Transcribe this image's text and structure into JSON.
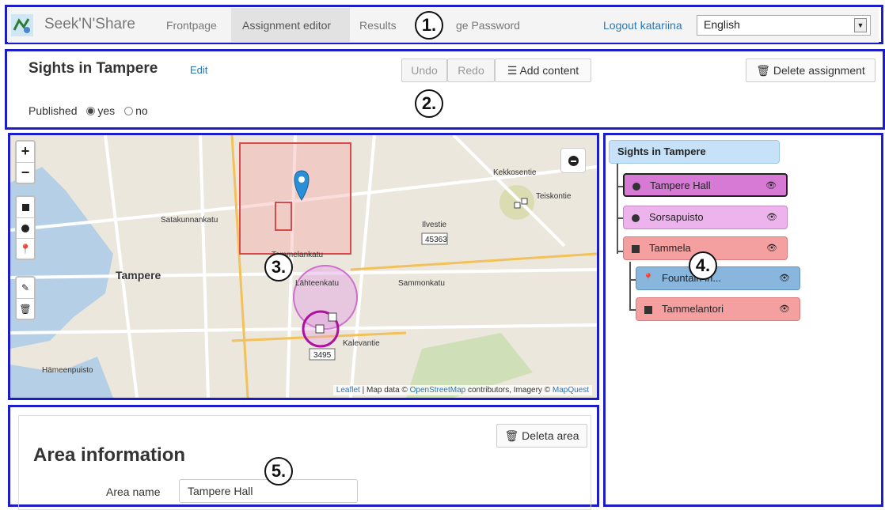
{
  "navbar": {
    "brand": "Seek'N'Share",
    "links": [
      "Frontpage",
      "Assignment editor",
      "Results",
      "ge Password"
    ],
    "logout": "Logout katariina",
    "language": "English"
  },
  "assignment": {
    "title": "Sights in Tampere",
    "edit": "Edit",
    "undo": "Undo",
    "redo": "Redo",
    "add_content": "Add content",
    "delete": "Delete assignment",
    "published_label": "Published",
    "yes": "yes",
    "no": "no"
  },
  "map": {
    "zoom_in": "+",
    "zoom_out": "−",
    "places": [
      "Tampere",
      "Lähteenkatu",
      "Kalevantie",
      "Tammelankatu",
      "Sammonkatu",
      "Satakunnankatu",
      "Hämeenpuisto",
      "Kekkosentie",
      "Teiskontie",
      "Ilvestie"
    ],
    "measure1": "45363",
    "measure2": "3495",
    "attr_leaflet": "Leaflet",
    "attr_text1": " | Map data © ",
    "attr_osm": "OpenStreetMap",
    "attr_text2": " contributors, Imagery © ",
    "attr_mq": "MapQuest"
  },
  "tree": {
    "root": "Sights in Tampere",
    "items": [
      "Tampere Hall",
      "Sorsapuisto",
      "Tammela",
      "Fountain in...",
      "Tammelantori"
    ]
  },
  "area": {
    "delete": "Deleta area",
    "heading": "Area information",
    "name_label": "Area name",
    "name_value": "Tampere Hall"
  },
  "callouts": [
    "1.",
    "2.",
    "3.",
    "4.",
    "5."
  ],
  "colors": {
    "frame": "#1c1cc8",
    "link": "#2a78b8",
    "pink": "#d67ad6",
    "red": "#f5a0a0",
    "blue": "#88b6dc",
    "root": "#c7e2f8"
  }
}
